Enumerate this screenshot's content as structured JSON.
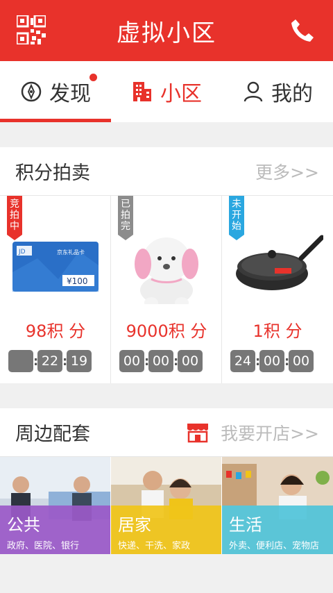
{
  "header": {
    "title": "虚拟小区",
    "left_icon": "qr-code-icon",
    "right_icon": "phone-icon"
  },
  "tabs": [
    {
      "label": "发现",
      "icon": "compass-icon",
      "has_badge": true
    },
    {
      "label": "小区",
      "icon": "building-icon",
      "active": true
    },
    {
      "label": "我的",
      "icon": "person-icon"
    }
  ],
  "auction": {
    "title": "积分拍卖",
    "more": "更多>>",
    "items": [
      {
        "ribbon": "竞拍中",
        "ribbon_color": "#e8322b",
        "product": "gift-card",
        "card_brand": "JD",
        "card_text": "京东礼品卡",
        "card_value": "¥100",
        "price": "98积 分",
        "timer": [
          "",
          "22",
          "19"
        ]
      },
      {
        "ribbon": "已拍完",
        "ribbon_color": "#8c8c8c",
        "product": "plush-dog",
        "price": "9000积 分",
        "timer": [
          "00",
          "00",
          "00"
        ]
      },
      {
        "ribbon": "未开始",
        "ribbon_color": "#2aa7e0",
        "product": "wok-pan",
        "price": "1积 分",
        "timer": [
          "24",
          "00",
          "00"
        ]
      }
    ]
  },
  "services": {
    "title": "周边配套",
    "store_icon": "storefront-icon",
    "open_store": "我要开店>>",
    "tiles": [
      {
        "name": "公共",
        "sub": "政府、医院、银行",
        "color": "#9b59c8"
      },
      {
        "name": "居家",
        "sub": "快递、干洗、家政",
        "color": "#f0c419"
      },
      {
        "name": "生活",
        "sub": "外卖、便利店、宠物店",
        "color": "#4fc3d9"
      }
    ]
  },
  "colors": {
    "brand": "#e8322b"
  }
}
